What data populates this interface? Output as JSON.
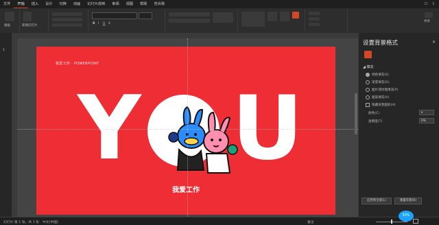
{
  "tabs": [
    "文件",
    "开始",
    "插入",
    "设计",
    "切换",
    "动画",
    "幻灯片放映",
    "审阅",
    "视图",
    "帮助",
    "告诉我"
  ],
  "active_tab": "开始",
  "ribbon": {
    "groups": [
      "剪贴板",
      "幻灯片",
      "字体",
      "段落",
      "绘图",
      "编辑"
    ],
    "paste_label": "粘贴",
    "new_slide_label": "新建幻灯片",
    "share_label": "共享"
  },
  "slide": {
    "number": "1",
    "small_title": "我爱工作 · POWERPOINT",
    "big_left": "Y",
    "big_right": "U",
    "subtitle": "我爱工作",
    "background_color": "#ee2d35"
  },
  "format_pane": {
    "title": "设置背景格式",
    "section": "填充",
    "options": [
      "纯色填充(S)",
      "渐变填充(G)",
      "图片或纹理填充(P)",
      "图案填充(A)",
      "隐藏背景图形(H)"
    ],
    "selected_option": "纯色填充(S)",
    "color_label": "颜色(C)",
    "transparency_label": "透明度(T)",
    "transparency_value": "0%",
    "apply_all": "应用到全部(L)",
    "reset": "重置背景(B)"
  },
  "status": {
    "slide_info": "幻灯片 第 1 张，共 1 张",
    "lang": "中文(中国)",
    "notes": "备注",
    "zoom_badge": "50%"
  }
}
